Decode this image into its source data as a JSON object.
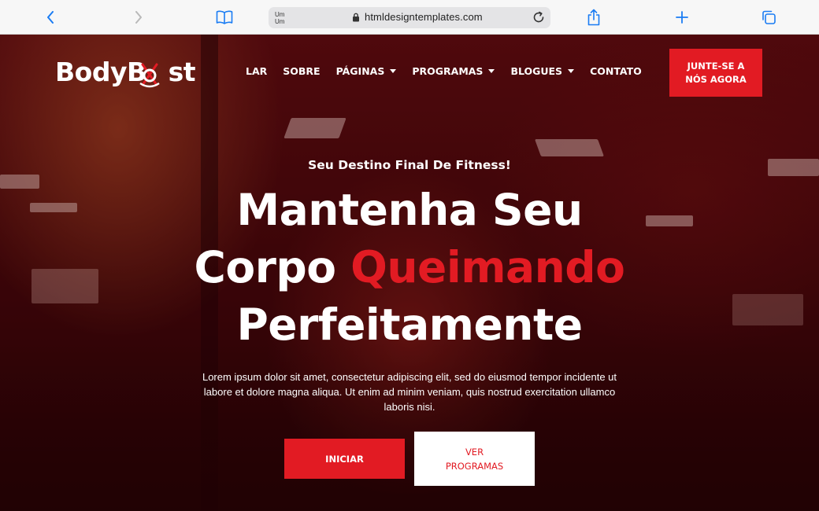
{
  "browser": {
    "reader_label": "Um Um",
    "url": "htmldesigntemplates.com",
    "icons": [
      "back-icon",
      "forward-icon",
      "bookmarks-icon",
      "lock-icon",
      "reload-icon",
      "share-icon",
      "new-tab-icon",
      "tabs-icon"
    ]
  },
  "site": {
    "logo_text": "BodyB",
    "logo_text_end": "st",
    "nav": [
      {
        "label": "LAR",
        "dropdown": false
      },
      {
        "label": "SOBRE",
        "dropdown": false
      },
      {
        "label": "PÁGINAS",
        "dropdown": true
      },
      {
        "label": "PROGRAMAS",
        "dropdown": true
      },
      {
        "label": "BLOGUES",
        "dropdown": true
      },
      {
        "label": "CONTATO",
        "dropdown": false
      }
    ],
    "join_button": "JUNTE-SE A NÓS AGORA"
  },
  "hero": {
    "tagline": "Seu Destino Final De Fitness!",
    "headline_line1": "Mantenha Seu",
    "headline_line2_a": "Corpo",
    "headline_line2_b": "Queimando",
    "headline_line3": "Perfeitamente",
    "description": "Lorem ipsum dolor sit amet, consectetur adipiscing elit, sed do eiusmod tempor incidente ut labore et dolore magna aliqua. Ut enim ad minim veniam, quis nostrud exercitation ullamco laboris nisi.",
    "primary_button": "INICIAR",
    "secondary_button": "VER PROGRAMAS"
  },
  "colors": {
    "accent": "#e21b23",
    "browser_icon": "#1a7cf3"
  }
}
